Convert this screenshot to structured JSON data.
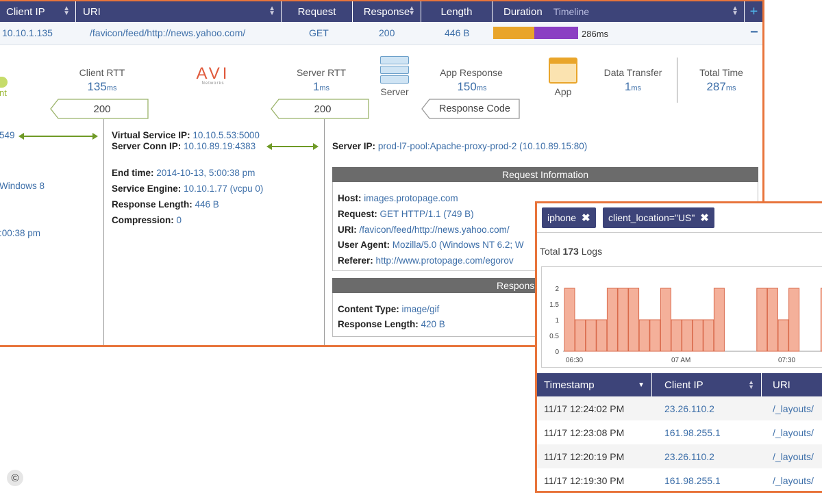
{
  "log_table": {
    "headers": [
      "Client IP",
      "URI",
      "Request",
      "Response",
      "Length",
      "Duration",
      "Timeline"
    ],
    "row": {
      "client_ip": "10.10.1.135",
      "uri": "/favicon/feed/http://news.yahoo.com/",
      "request": "GET",
      "response": "200",
      "length": "446 B",
      "duration": "286ms",
      "collapse": "−"
    },
    "plus": "+"
  },
  "timing": {
    "client_rtt_label": "Client RTT",
    "client_rtt_value": "135",
    "client_rtt_unit": "ms",
    "avi_logo": "AVI",
    "avi_sub": "Networks",
    "server_rtt_label": "Server RTT",
    "server_rtt_value": "1",
    "server_rtt_unit": "ms",
    "server_label": "Server",
    "app_response_label": "App Response",
    "app_response_value": "150",
    "app_response_unit": "ms",
    "app_label": "App",
    "data_transfer_label": "Data Transfer",
    "data_transfer_value": "1",
    "data_transfer_unit": "ms",
    "total_time_label": "Total Time",
    "total_time_value": "287",
    "total_time_unit": "ms",
    "client_code": "200",
    "server_code": "200",
    "response_code_label": "Response Code",
    "client_fragment": "nt"
  },
  "client_details": {
    "port_fragment": "549",
    "os_fragment": "Windows 8",
    "time_fragment": ":00:38 pm"
  },
  "virtual_service": {
    "vs_ip_label": "Virtual Service IP:",
    "vs_ip": "10.10.5.53:5000",
    "conn_ip_label": "Server Conn IP:",
    "conn_ip": "10.10.89.19:4383",
    "end_time_label": "End time:",
    "end_time": "2014-10-13, 5:00:38 pm",
    "engine_label": "Service Engine:",
    "engine": "10.10.1.77 (vcpu 0)",
    "resp_len_label": "Response Length:",
    "resp_len": "446 B",
    "compression_label": "Compression:",
    "compression": "0"
  },
  "server": {
    "server_ip_label": "Server IP:",
    "server_ip": "prod-l7-pool:Apache-proxy-prod-2 (10.10.89.15:80)"
  },
  "request_info": {
    "title": "Request Information",
    "host_label": "Host:",
    "host": "images.protopage.com",
    "request_label": "Request:",
    "request": "GET HTTP/1.1 (749 B)",
    "uri_label": "URI:",
    "uri": "/favicon/feed/http://news.yahoo.com/",
    "ua_label": "User Agent:",
    "ua": "Mozilla/5.0 (Windows NT 6.2; W",
    "referer_label": "Referer:",
    "referer": "http://www.protopage.com/egorov"
  },
  "response_info": {
    "title": "Respons",
    "ctype_label": "Content Type:",
    "ctype": "image/gif",
    "len_label": "Response Length:",
    "len": "420 B"
  },
  "filters": [
    {
      "label": "iphone",
      "remove": "✖"
    },
    {
      "label": "client_location=\"US\"",
      "remove": "✖"
    }
  ],
  "total_logs": {
    "prefix": "Total",
    "count": "173",
    "suffix": "Logs"
  },
  "chart_data": {
    "type": "bar",
    "y_ticks": [
      "2",
      "1.5",
      "1",
      "0.5",
      "0"
    ],
    "ylim": [
      0,
      2
    ],
    "x_ticks": [
      "06:30",
      "07 AM",
      "07:30"
    ],
    "values": [
      2,
      1,
      1,
      1,
      2,
      2,
      2,
      1,
      1,
      2,
      1,
      1,
      1,
      1,
      2,
      0,
      0,
      0,
      2,
      2,
      1,
      2,
      0,
      0,
      2,
      2,
      1,
      2
    ],
    "bar_color": "#f4b09a",
    "bar_edge": "#d96a4b"
  },
  "logs_table": {
    "headers": [
      "Timestamp",
      "Client IP",
      "URI"
    ],
    "rows": [
      {
        "timestamp": "11/17 12:24:02 PM",
        "client_ip": "23.26.110.2",
        "uri": "/_layouts/"
      },
      {
        "timestamp": "11/17 12:23:08 PM",
        "client_ip": "161.98.255.1",
        "uri": "/_layouts/"
      },
      {
        "timestamp": "11/17 12:20:19 PM",
        "client_ip": "23.26.110.2",
        "uri": "/_layouts/"
      },
      {
        "timestamp": "11/17 12:19:30 PM",
        "client_ip": "161.98.255.1",
        "uri": "/_layouts/"
      }
    ]
  },
  "copyright": "©"
}
